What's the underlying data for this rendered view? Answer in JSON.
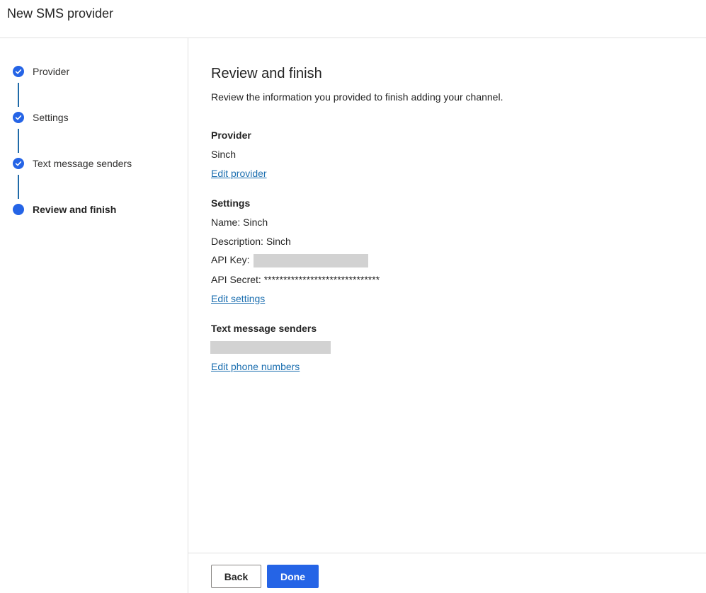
{
  "header": {
    "title": "New SMS provider"
  },
  "steps": [
    {
      "label": "Provider",
      "state": "complete"
    },
    {
      "label": "Settings",
      "state": "complete"
    },
    {
      "label": "Text message senders",
      "state": "complete"
    },
    {
      "label": "Review and finish",
      "state": "current"
    }
  ],
  "main": {
    "title": "Review and finish",
    "description": "Review the information you provided to finish adding your channel.",
    "provider": {
      "heading": "Provider",
      "value": "Sinch",
      "edit_link": "Edit provider"
    },
    "settings": {
      "heading": "Settings",
      "name_label": "Name:",
      "name_value": "Sinch",
      "description_label": "Description:",
      "description_value": "Sinch",
      "api_key_label": "API Key:",
      "api_secret_label": "API Secret:",
      "api_secret_value": "******************************",
      "edit_link": "Edit settings"
    },
    "senders": {
      "heading": "Text message senders",
      "edit_link": "Edit phone numbers"
    }
  },
  "footer": {
    "back_label": "Back",
    "done_label": "Done"
  },
  "colors": {
    "accent": "#2564e6",
    "link": "#1c6fb0",
    "step_line": "#1f6aa8",
    "redaction": "#d2d2d2"
  }
}
